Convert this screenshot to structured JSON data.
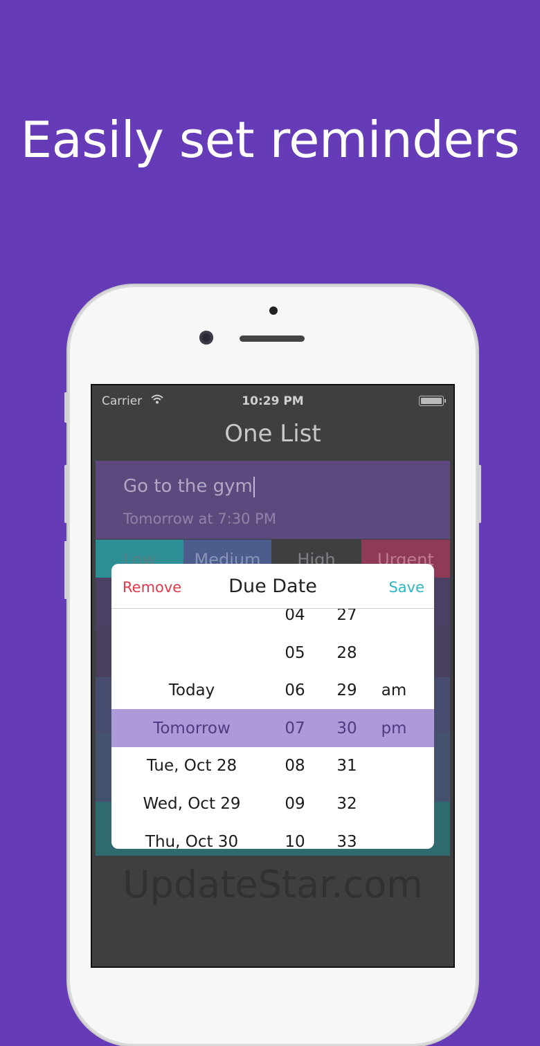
{
  "headline": "Easily set reminders",
  "status_bar": {
    "carrier": "Carrier",
    "time": "10:29 PM"
  },
  "app": {
    "title": "One List"
  },
  "task": {
    "title": "Go to the gym",
    "due": "Tomorrow at 7:30 PM"
  },
  "priority": {
    "low": "Low",
    "medium": "Medium",
    "high": "High",
    "urgent": "Urgent"
  },
  "modal": {
    "remove": "Remove",
    "title": "Due Date",
    "save": "Save"
  },
  "picker": {
    "rows": [
      {
        "day": "",
        "hour": "04",
        "minute": "27",
        "ampm": ""
      },
      {
        "day": "",
        "hour": "05",
        "minute": "28",
        "ampm": ""
      },
      {
        "day": "Today",
        "hour": "06",
        "minute": "29",
        "ampm": "am"
      },
      {
        "day": "Tomorrow",
        "hour": "07",
        "minute": "30",
        "ampm": "pm"
      },
      {
        "day": "Tue, Oct 28",
        "hour": "08",
        "minute": "31",
        "ampm": ""
      },
      {
        "day": "Wed, Oct 29",
        "hour": "09",
        "minute": "32",
        "ampm": ""
      },
      {
        "day": "Thu, Oct 30",
        "hour": "10",
        "minute": "33",
        "ampm": ""
      }
    ],
    "selected_index": 3
  },
  "watermark": "UpdateStar.com",
  "colors": {
    "background": "#663bb7",
    "selection": "#ae9ad9",
    "remove": "#e03a4a",
    "save": "#2bb7c3"
  }
}
